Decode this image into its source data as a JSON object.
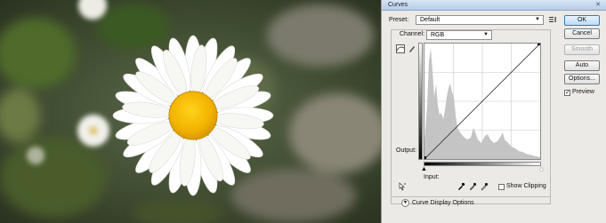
{
  "dialog": {
    "title": "Curves",
    "preset": {
      "label": "Preset:",
      "value": "Default"
    },
    "channel": {
      "label": "Channel:",
      "value": "RGB"
    },
    "output_label": "Output:",
    "input_label": "Input:",
    "show_clipping_label": "Show Clipping",
    "show_clipping_checked": false,
    "curve_display_options_label": "Curve Display Options",
    "buttons": {
      "ok": "OK",
      "cancel": "Cancel",
      "smooth": "Smooth",
      "auto": "Auto",
      "options": "Options..."
    },
    "preview": {
      "label": "Preview",
      "checked": true
    }
  },
  "photo": {
    "subject": "white daisy with yellow center on blurred green background"
  },
  "colors": {
    "dialog_bg": "#eceae6",
    "accent": "#3d7bad",
    "histogram": "#c4c4c4",
    "daisy_center": "#f2b800"
  },
  "icons": [
    "curve-point-tool-icon",
    "pencil-tool-icon",
    "preset-options-icon",
    "on-image-adjust-icon",
    "black-eyedropper-icon",
    "gray-eyedropper-icon",
    "white-eyedropper-icon",
    "chevron-down-icon"
  ]
}
